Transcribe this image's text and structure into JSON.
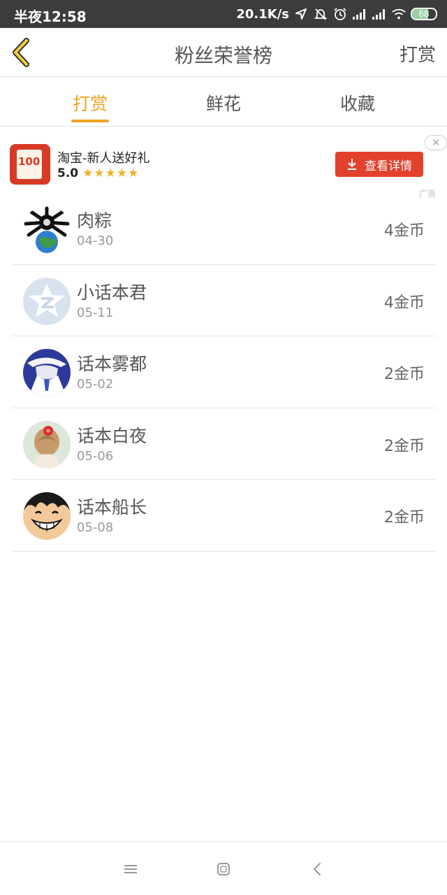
{
  "status_bar": {
    "time": "半夜12:58",
    "network_speed": "20.1K/s",
    "battery_level": "68",
    "battery_fraction": 0.68
  },
  "header": {
    "title": "粉丝荣誉榜",
    "action": "打赏"
  },
  "tabs": [
    {
      "label": "打赏",
      "active": true
    },
    {
      "label": "鲜花",
      "active": false
    },
    {
      "label": "收藏",
      "active": false
    }
  ],
  "ad": {
    "title": "淘宝-新人送好礼",
    "rating": "5.0",
    "stars": "★★★★★",
    "button_label": "查看详情",
    "icon_text": "100",
    "close_symbol": "✕",
    "tag": "广告"
  },
  "fans": [
    {
      "name": "肉粽",
      "date": "04-30",
      "amount": "4金币",
      "avatar": "spider-globe-avatar"
    },
    {
      "name": "小话本君",
      "date": "05-11",
      "amount": "4金币",
      "avatar": "qq-z-avatar"
    },
    {
      "name": "话本雾都",
      "date": "05-02",
      "amount": "2金币",
      "avatar": "anime-hat-avatar"
    },
    {
      "name": "话本白夜",
      "date": "05-06",
      "amount": "2金币",
      "avatar": "hair-flower-avatar"
    },
    {
      "name": "话本船长",
      "date": "05-08",
      "amount": "2金币",
      "avatar": "luffy-avatar"
    }
  ],
  "colors": {
    "accent": "#f0a321",
    "ad_button": "#e2412d",
    "status_bar": "#3c3c3c"
  }
}
